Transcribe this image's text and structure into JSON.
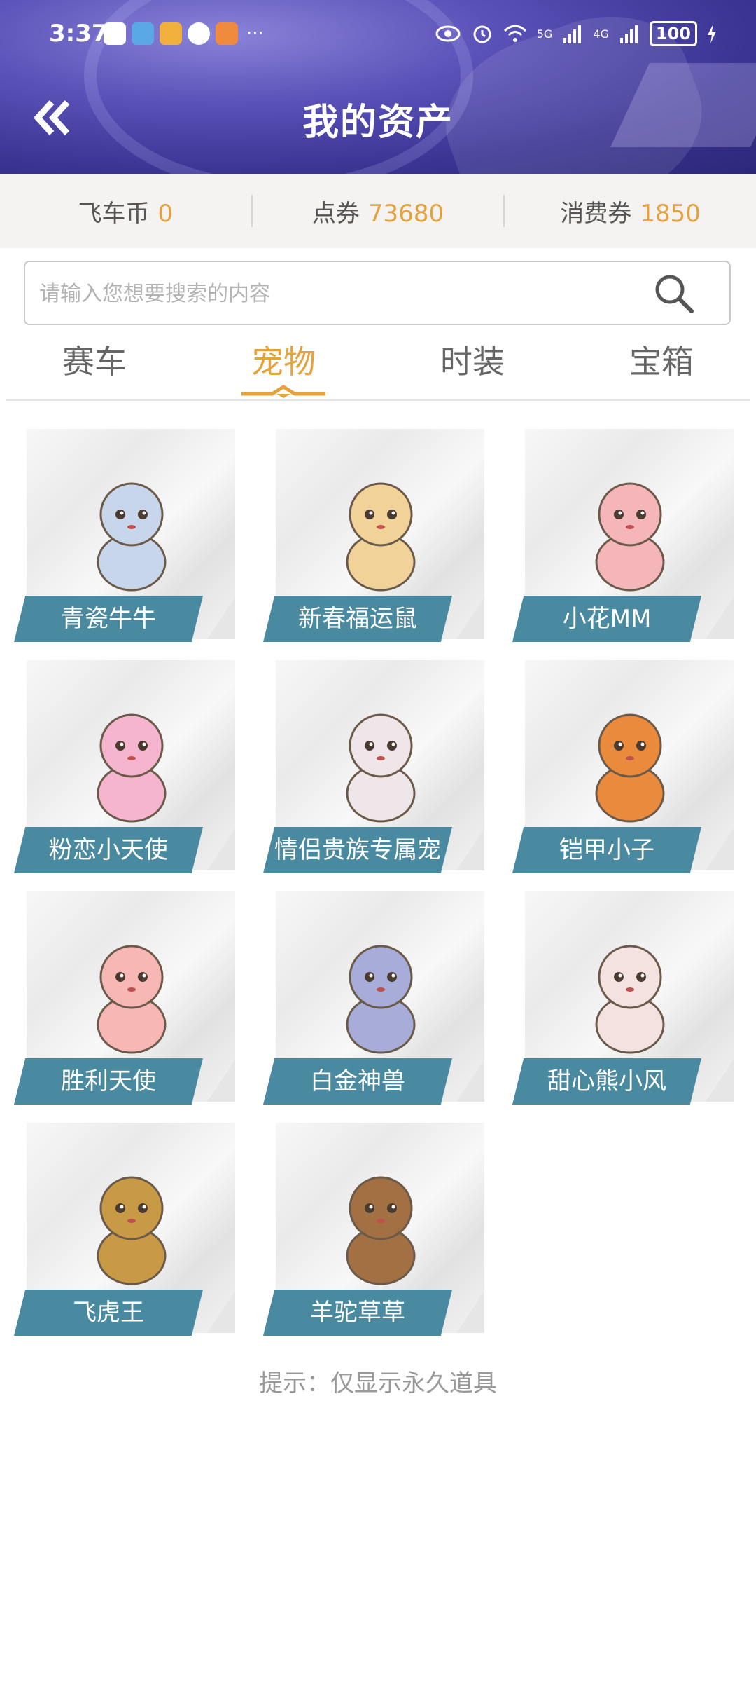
{
  "status_bar": {
    "time": "3:37",
    "more": "···",
    "battery": "100",
    "net1": "5G",
    "net2": "4G"
  },
  "header": {
    "title": "我的资产"
  },
  "currency": [
    {
      "label": "飞车币",
      "value": "0"
    },
    {
      "label": "点券",
      "value": "73680"
    },
    {
      "label": "消费券",
      "value": "1850"
    }
  ],
  "search": {
    "placeholder": "请输入您想要搜索的内容",
    "value": ""
  },
  "tabs": [
    {
      "label": "赛车",
      "active": false
    },
    {
      "label": "宠物",
      "active": true
    },
    {
      "label": "时装",
      "active": false
    },
    {
      "label": "宝箱",
      "active": false
    }
  ],
  "pets": [
    {
      "name": "青瓷牛牛",
      "icon": "porcelain-cow-icon",
      "color": "#c8d6ec"
    },
    {
      "name": "新春福运鼠",
      "icon": "hamster-icon",
      "color": "#f1d39a"
    },
    {
      "name": "小花MM",
      "icon": "girl-doll-icon",
      "color": "#f4b6b8"
    },
    {
      "name": "粉恋小天使",
      "icon": "pink-angel-icon",
      "color": "#f6b5cf"
    },
    {
      "name": "情侣贵族专属宠",
      "icon": "white-angel-icon",
      "color": "#efe6e9"
    },
    {
      "name": "铠甲小子",
      "icon": "robot-icon",
      "color": "#e98a3c"
    },
    {
      "name": "胜利天使",
      "icon": "victory-angel-icon",
      "color": "#f7b7b4"
    },
    {
      "name": "白金神兽",
      "icon": "platinum-beast-icon",
      "color": "#a7acd8"
    },
    {
      "name": "甜心熊小风",
      "icon": "bear-icon",
      "color": "#f3e2e0"
    },
    {
      "name": "飞虎王",
      "icon": "tiger-icon",
      "color": "#c99a45"
    },
    {
      "name": "羊驼草草",
      "icon": "alpaca-icon",
      "color": "#a27042"
    }
  ],
  "hint": "提示：仅显示永久道具",
  "colors": {
    "accent": "#e6a23c",
    "plate": "#4a8aa0",
    "header": "#4a43a6"
  }
}
